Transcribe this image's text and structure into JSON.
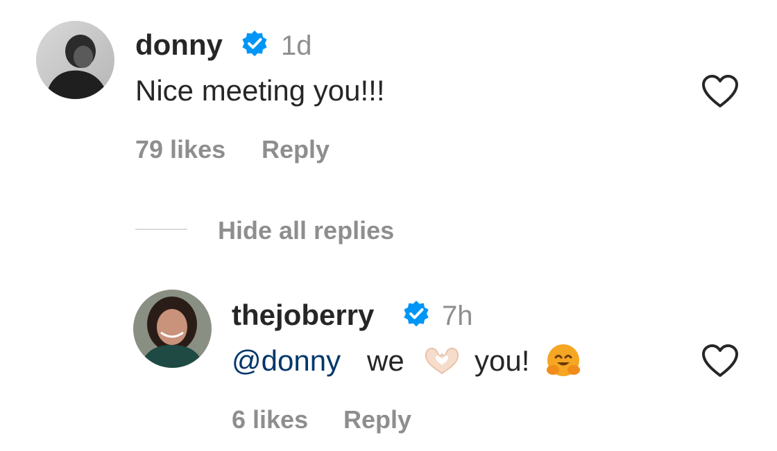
{
  "comments": [
    {
      "username": "donny",
      "verified": true,
      "time": "1d",
      "text": "Nice meeting you!!!",
      "likes": "79 likes",
      "reply_label": "Reply",
      "like_icon": "heart-outline-icon"
    }
  ],
  "replies_toggle": {
    "label": "Hide all replies"
  },
  "replies": [
    {
      "username": "thejoberry",
      "verified": true,
      "time": "7h",
      "mention": "@donny",
      "text_parts": [
        "we",
        "you!"
      ],
      "emojis": [
        "heart-hands-emoji",
        "hugging-face-emoji"
      ],
      "likes": "6 likes",
      "reply_label": "Reply",
      "like_icon": "heart-outline-icon"
    }
  ],
  "colors": {
    "text": "#262626",
    "secondary": "#8e8e8e",
    "verified": "#0095f6",
    "mention": "#00376b",
    "divider": "#dbdbdb"
  }
}
